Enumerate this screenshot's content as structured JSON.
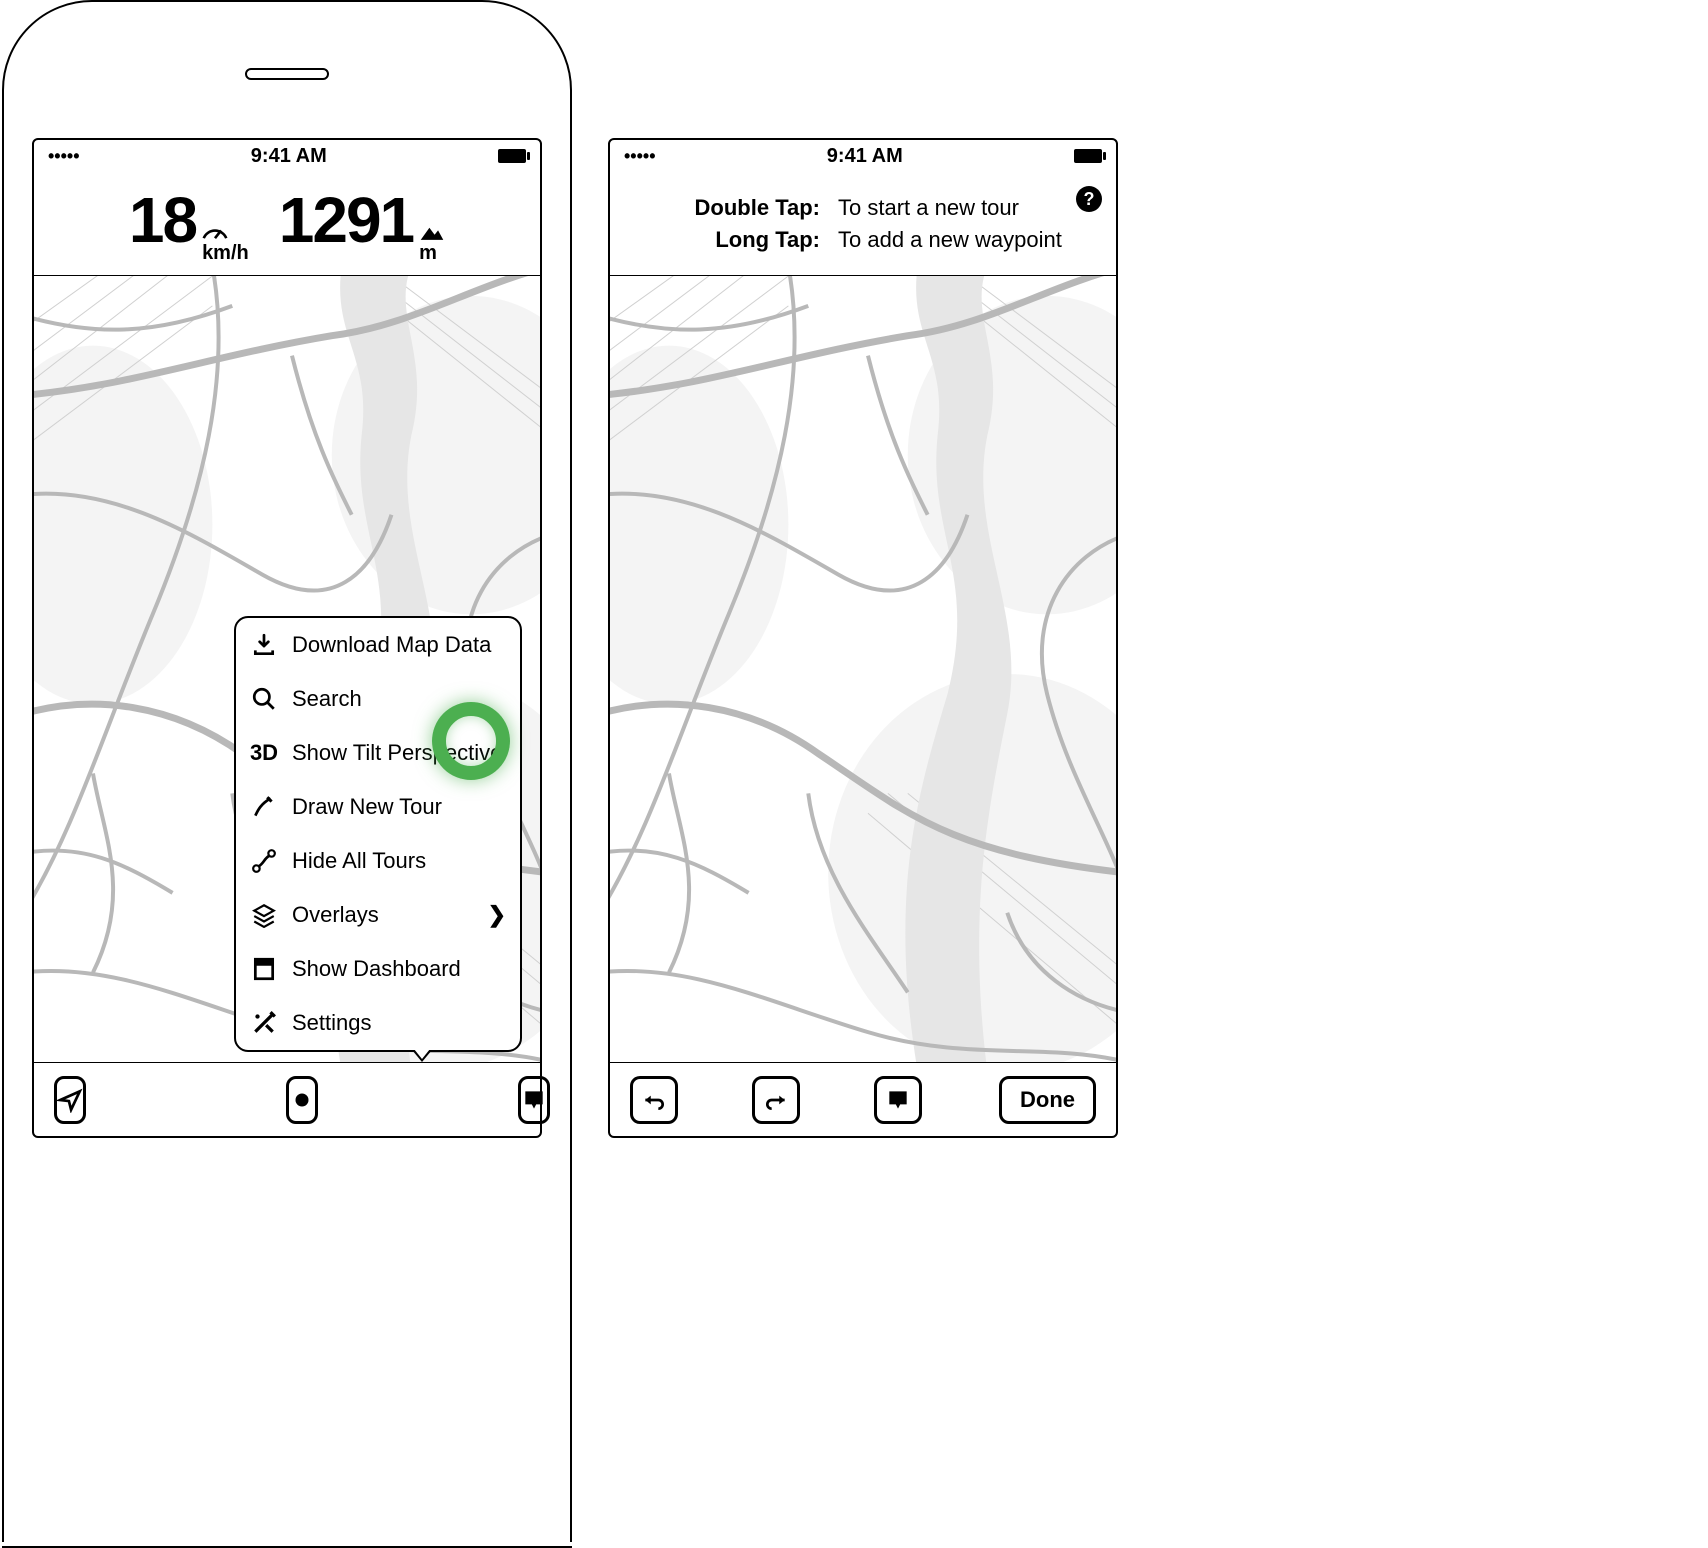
{
  "status": {
    "dots": "•••••",
    "time": "9:41 AM"
  },
  "dashboard": {
    "speed_value": "18",
    "speed_unit": "km/h",
    "alt_value": "1291",
    "alt_unit": "m"
  },
  "menu": {
    "items": [
      {
        "icon": "download-icon",
        "label": "Download Map Data"
      },
      {
        "icon": "search-icon",
        "label": "Search"
      },
      {
        "icon": "threed-icon",
        "label": "Show Tilt Perspective"
      },
      {
        "icon": "pencil-icon",
        "label": "Draw New Tour"
      },
      {
        "icon": "route-icon",
        "label": "Hide All Tours"
      },
      {
        "icon": "overlays-icon",
        "label": "Overlays",
        "chevron": true
      },
      {
        "icon": "dashboard-icon",
        "label": "Show Dashboard"
      },
      {
        "icon": "settings-icon",
        "label": "Settings"
      }
    ],
    "threed_text": "3D"
  },
  "instructions": {
    "double_tap_key": "Double Tap:",
    "double_tap_val": "To start a new tour",
    "long_tap_key": "Long Tap:",
    "long_tap_val": "To add a new waypoint",
    "help": "?"
  },
  "done_label": "Done",
  "chevron": "❯"
}
